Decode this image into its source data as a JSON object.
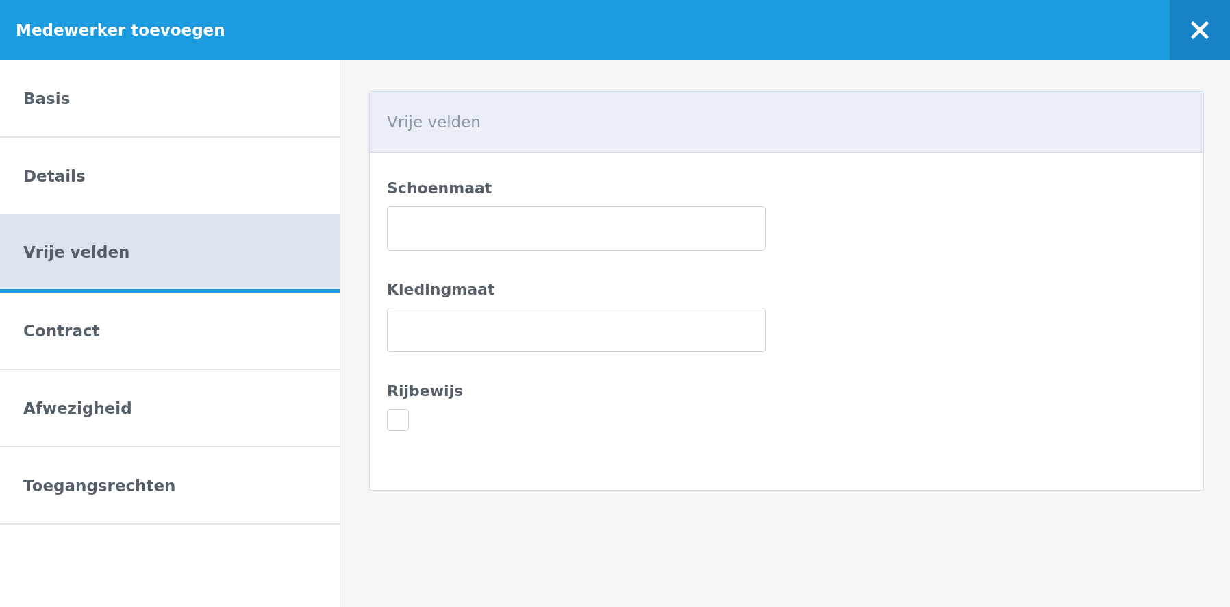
{
  "window": {
    "title": "Medewerker toevoegen"
  },
  "sidebar": {
    "items": [
      {
        "label": "Basis",
        "selected": false
      },
      {
        "label": "Details",
        "selected": false
      },
      {
        "label": "Vrije velden",
        "selected": true
      },
      {
        "label": "Contract",
        "selected": false
      },
      {
        "label": "Afwezigheid",
        "selected": false
      },
      {
        "label": "Toegangsrechten",
        "selected": false
      }
    ]
  },
  "panel": {
    "title": "Vrije velden",
    "fields": [
      {
        "kind": "text",
        "label": "Schoenmaat"
      },
      {
        "kind": "text",
        "label": "Kledingmaat"
      },
      {
        "kind": "checkbox",
        "label": "Rijbewijs",
        "checked": false
      }
    ]
  }
}
